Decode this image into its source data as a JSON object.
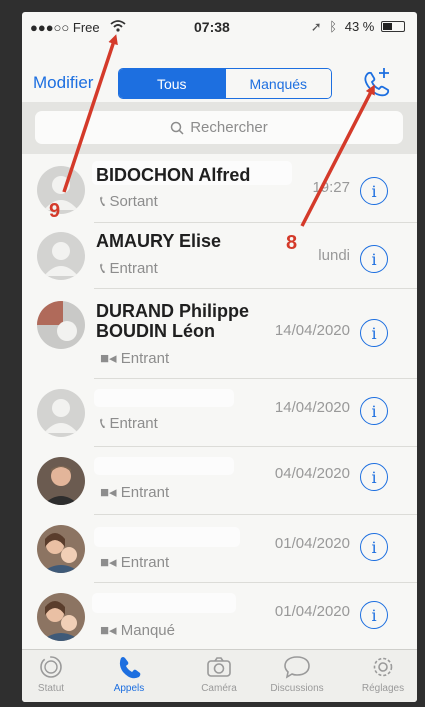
{
  "status_bar": {
    "carrier": "●●●○○ Free",
    "time": "07:38",
    "battery": "43 %",
    "battery_level": 0.43
  },
  "nav": {
    "edit_label": "Modifier",
    "tabs": [
      "Tous",
      "Manqués"
    ]
  },
  "search": {
    "placeholder": "Rechercher"
  },
  "calls": [
    {
      "name": "BIDOCHON  Alfred",
      "type": "Sortant",
      "time": "19:27",
      "icon": "phone-icon"
    },
    {
      "name": "AMAURY Elise",
      "type": "Entrant",
      "time": "lundi",
      "icon": "phone-icon"
    },
    {
      "name": "DURAND Philippe\nBOUDIN Léon",
      "type": "Entrant",
      "time": "14/04/2020",
      "icon": "video-icon"
    },
    {
      "name": "",
      "type": "Entrant",
      "time": "14/04/2020",
      "icon": "phone-icon"
    },
    {
      "name": "",
      "type": "Entrant",
      "time": "04/04/2020",
      "icon": "video-icon"
    },
    {
      "name": "",
      "type": "Entrant",
      "time": "01/04/2020",
      "icon": "video-icon"
    },
    {
      "name": "",
      "type": "Manqué",
      "time": "01/04/2020",
      "icon": "video-icon"
    }
  ],
  "tabbar": [
    {
      "label": "Statut",
      "icon": "status-icon"
    },
    {
      "label": "Appels",
      "icon": "phone-icon"
    },
    {
      "label": "Caméra",
      "icon": "camera-icon"
    },
    {
      "label": "Discussions",
      "icon": "chat-icon"
    },
    {
      "label": "Réglages",
      "icon": "gear-icon"
    }
  ],
  "annotations": [
    {
      "label": "9"
    },
    {
      "label": "8"
    }
  ],
  "colors": {
    "accent": "#1d6fe0",
    "annotation": "#d43a2a"
  }
}
